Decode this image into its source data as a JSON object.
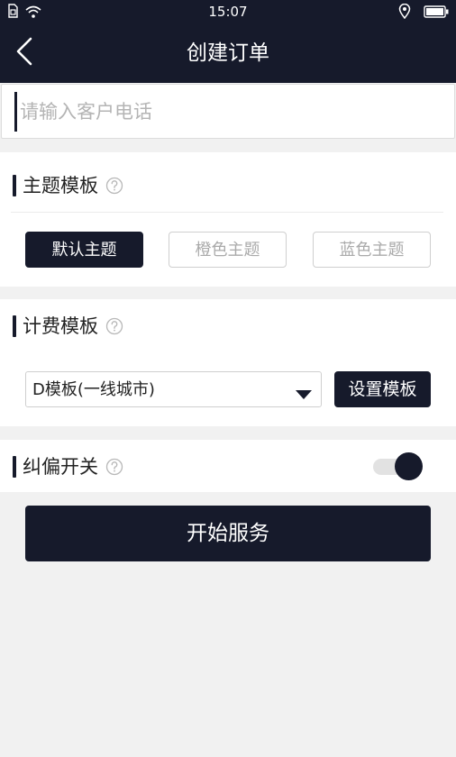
{
  "status_bar": {
    "time": "15:07",
    "icons": [
      "sim-icon",
      "wifi-icon",
      "location-icon",
      "battery-icon"
    ]
  },
  "nav": {
    "title": "创建订单",
    "back_icon": "chevron-left-icon"
  },
  "phone": {
    "placeholder": "请输入客户电话",
    "value": ""
  },
  "theme_section": {
    "title": "主题模板",
    "help_icon": "question-circle-icon",
    "options": [
      {
        "label": "默认主题",
        "selected": true
      },
      {
        "label": "橙色主题",
        "selected": false
      },
      {
        "label": "蓝色主题",
        "selected": false
      }
    ]
  },
  "billing_section": {
    "title": "计费模板",
    "help_icon": "question-circle-icon",
    "selected_template": "D模板(一线城市)",
    "setup_label": "设置模板"
  },
  "correction_section": {
    "title": "纠偏开关",
    "help_icon": "question-circle-icon",
    "enabled": true
  },
  "start_button": {
    "label": "开始服务"
  },
  "colors": {
    "primary": "#161a2b",
    "background": "#f1f1f1",
    "card": "#ffffff",
    "muted_text": "#aaaaaa",
    "border": "#cfcfcf"
  }
}
